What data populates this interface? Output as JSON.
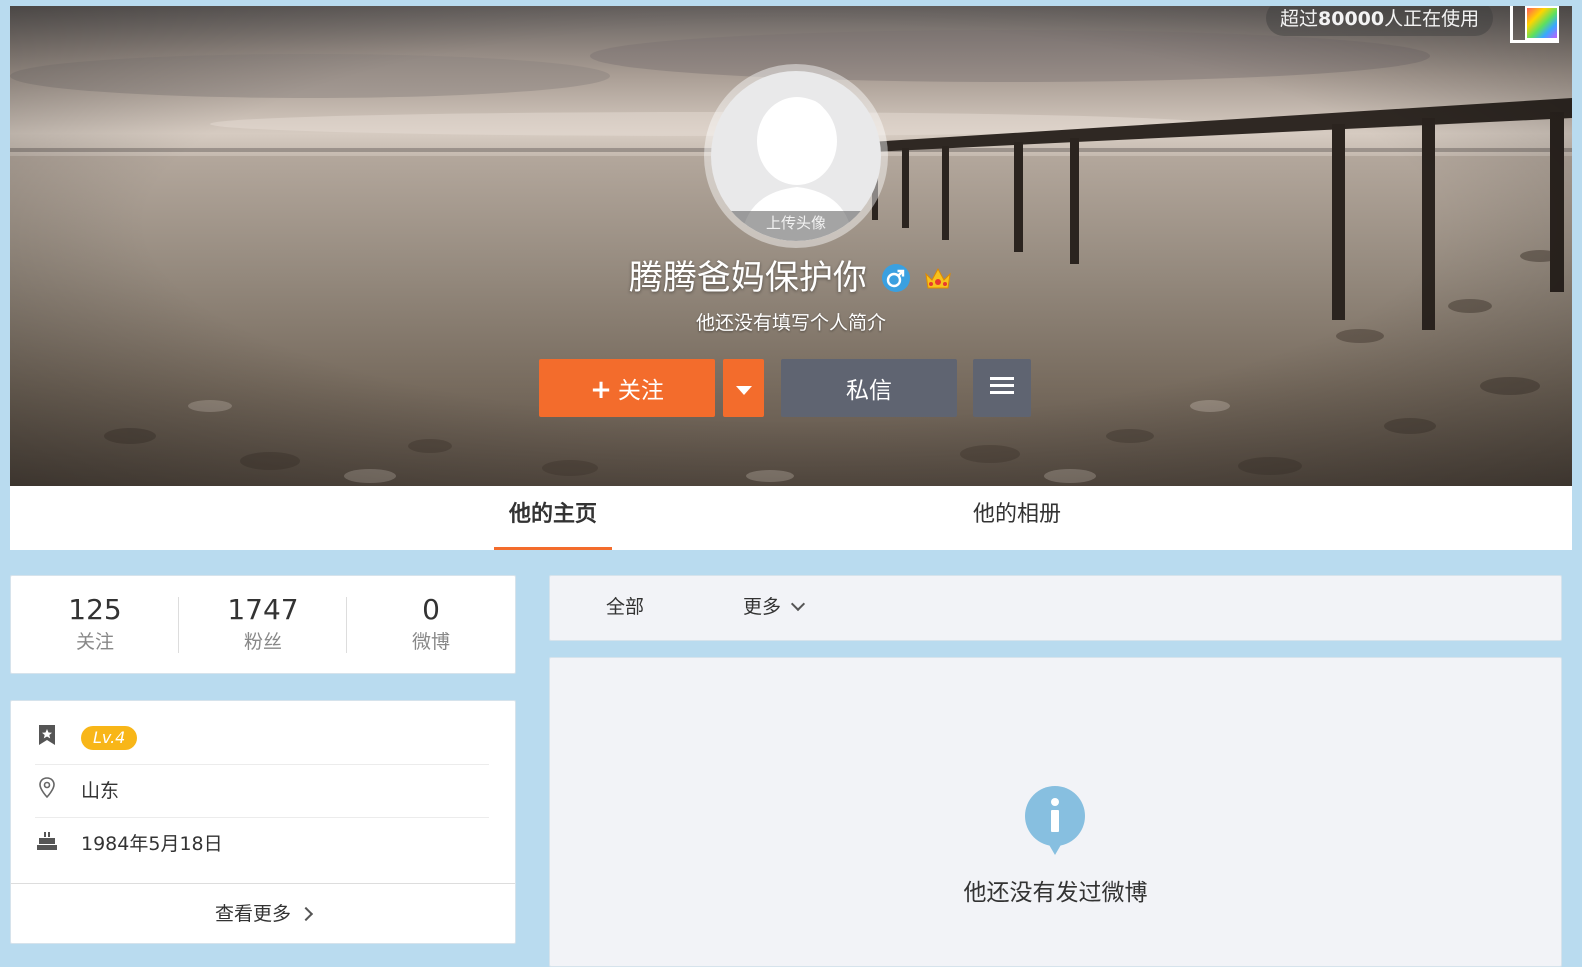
{
  "cover": {
    "ad_prefix": "超过",
    "ad_count": "80000",
    "ad_suffix": "人正在使用"
  },
  "profile": {
    "upload_avatar_label": "上传头像",
    "name": "腾腾爸妈保护你",
    "bio": "他还没有填写个人简介",
    "gender_icon": "male-icon",
    "member_icon": "crown-icon"
  },
  "actions": {
    "follow_plus": "+",
    "follow_label": "关注",
    "message_label": "私信",
    "menu_icon": "menu-icon",
    "dropdown_icon": "caret-down-icon"
  },
  "tabs": [
    {
      "label": "他的主页",
      "active": true
    },
    {
      "label": "他的相册",
      "active": false
    }
  ],
  "stats": [
    {
      "value": "125",
      "label": "关注"
    },
    {
      "value": "1747",
      "label": "粉丝"
    },
    {
      "value": "0",
      "label": "微博"
    }
  ],
  "info": {
    "level": "Lv.4",
    "location": "山东",
    "birthday": "1984年5月18日",
    "see_more": "查看更多"
  },
  "feed": {
    "filter_all": "全部",
    "filter_more": "更多",
    "empty_text": "他还没有发过微博"
  },
  "colors": {
    "accent": "#f36c2c",
    "button_dark": "#5f6471",
    "level_badge": "#f8b618",
    "page_bg": "#b9dbef",
    "info_icon": "#87bfe0"
  }
}
